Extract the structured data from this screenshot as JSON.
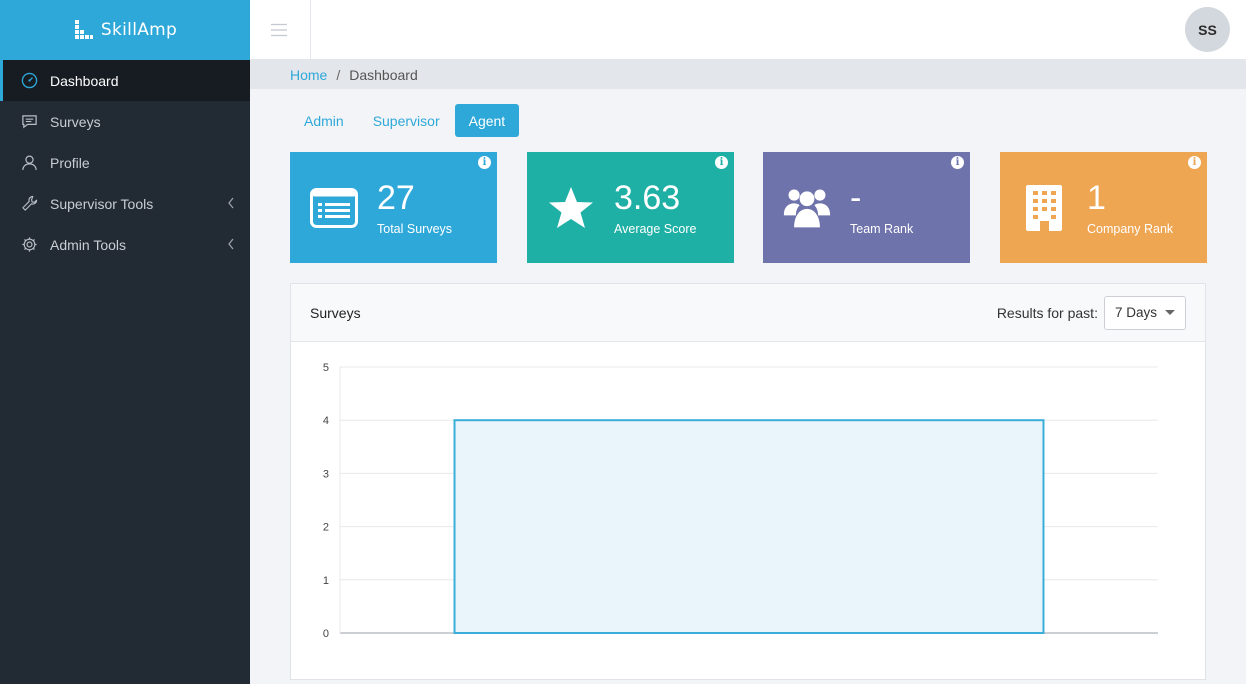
{
  "brand": {
    "name": "SkillAmp"
  },
  "sidebar": {
    "items": [
      {
        "label": "Dashboard",
        "icon": "dashboard-icon",
        "active": true
      },
      {
        "label": "Surveys",
        "icon": "comment-icon"
      },
      {
        "label": "Profile",
        "icon": "user-icon"
      },
      {
        "label": "Supervisor Tools",
        "icon": "wrench-icon",
        "expandable": true
      },
      {
        "label": "Admin Tools",
        "icon": "gear-icon",
        "expandable": true
      }
    ]
  },
  "topbar": {
    "avatar_initials": "SS"
  },
  "breadcrumb": {
    "home": "Home",
    "separator": "/",
    "current": "Dashboard"
  },
  "tabs": [
    {
      "label": "Admin"
    },
    {
      "label": "Supervisor"
    },
    {
      "label": "Agent",
      "active": true
    }
  ],
  "cards": [
    {
      "value": "27",
      "label": "Total Surveys",
      "color": "#2ea8d9",
      "icon": "list-icon"
    },
    {
      "value": "3.63",
      "label": "Average Score",
      "color": "#1fb0a5",
      "icon": "star-icon"
    },
    {
      "value": "-",
      "label": "Team Rank",
      "color": "#6f73ac",
      "icon": "users-icon"
    },
    {
      "value": "1",
      "label": "Company Rank",
      "color": "#efa653",
      "icon": "building-icon"
    }
  ],
  "panel": {
    "title": "Surveys",
    "results_label": "Results for past:",
    "range_selected": "7 Days"
  },
  "chart_data": {
    "type": "bar",
    "categories": [
      ""
    ],
    "values": [
      4
    ],
    "ylim": [
      0,
      5
    ],
    "yticks": [
      0,
      1,
      2,
      3,
      4,
      5
    ],
    "grid": true,
    "colors": {
      "bar_fill": "#eaf5fb",
      "bar_stroke": "#3aaed8"
    }
  }
}
